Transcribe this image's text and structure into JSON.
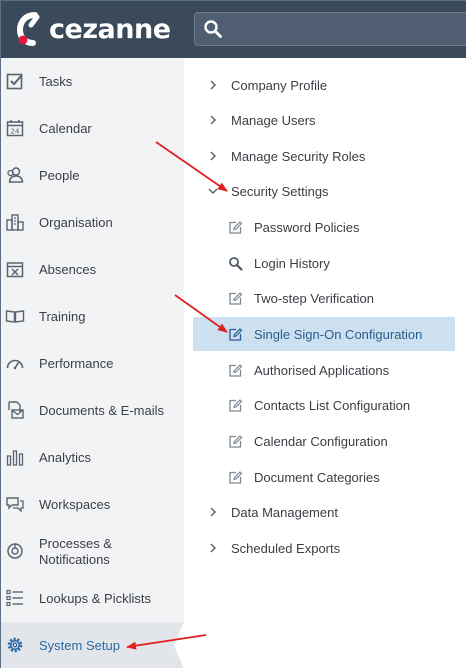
{
  "app": {
    "brand_name": "cezanne",
    "brand_color": "#e3173b",
    "header_color": "#3b4a5b"
  },
  "search": {
    "icon": "search-icon",
    "placeholder": ""
  },
  "sidebar": {
    "items": [
      {
        "label": "Tasks",
        "icon": "checkbox-icon"
      },
      {
        "label": "Calendar",
        "icon": "calendar-icon"
      },
      {
        "label": "People",
        "icon": "people-icon"
      },
      {
        "label": "Organisation",
        "icon": "organisation-icon"
      },
      {
        "label": "Absences",
        "icon": "absences-calendar-icon"
      },
      {
        "label": "Training",
        "icon": "book-icon"
      },
      {
        "label": "Performance",
        "icon": "gauge-icon"
      },
      {
        "label": "Documents & E-mails",
        "icon": "documents-icon"
      },
      {
        "label": "Analytics",
        "icon": "bar-chart-icon"
      },
      {
        "label": "Workspaces",
        "icon": "chat-bubbles-icon"
      },
      {
        "label": "Processes & Notifications",
        "icon": "processes-icon"
      },
      {
        "label": "Lookups & Picklists",
        "icon": "list-icon"
      },
      {
        "label": "System Setup",
        "icon": "gear-icon",
        "active": true
      }
    ]
  },
  "settings_menu": {
    "items": [
      {
        "label": "Company Profile",
        "level": 0,
        "state": "collapsed"
      },
      {
        "label": "Manage Users",
        "level": 0,
        "state": "collapsed"
      },
      {
        "label": "Manage Security Roles",
        "level": 0,
        "state": "collapsed"
      },
      {
        "label": "Security Settings",
        "level": 0,
        "state": "expanded"
      },
      {
        "label": "Password Policies",
        "level": 1,
        "icon": "edit-icon"
      },
      {
        "label": "Login History",
        "level": 1,
        "icon": "search-icon"
      },
      {
        "label": "Two-step Verification",
        "level": 1,
        "icon": "edit-icon"
      },
      {
        "label": "Single Sign-On Configuration",
        "level": 1,
        "icon": "edit-icon",
        "selected": true
      },
      {
        "label": "Authorised Applications",
        "level": 1,
        "icon": "edit-icon"
      },
      {
        "label": "Contacts List Configuration",
        "level": 1,
        "icon": "edit-icon"
      },
      {
        "label": "Calendar Configuration",
        "level": 1,
        "icon": "edit-icon"
      },
      {
        "label": "Document Categories",
        "level": 1,
        "icon": "edit-icon"
      },
      {
        "label": "Data Management",
        "level": 0,
        "state": "collapsed"
      },
      {
        "label": "Scheduled Exports",
        "level": 0,
        "state": "collapsed"
      }
    ]
  },
  "annotations": {
    "arrow_color": "#e02020",
    "arrows": [
      "arrow-to-security-settings",
      "arrow-to-single-sign-on",
      "arrow-to-system-setup"
    ]
  }
}
